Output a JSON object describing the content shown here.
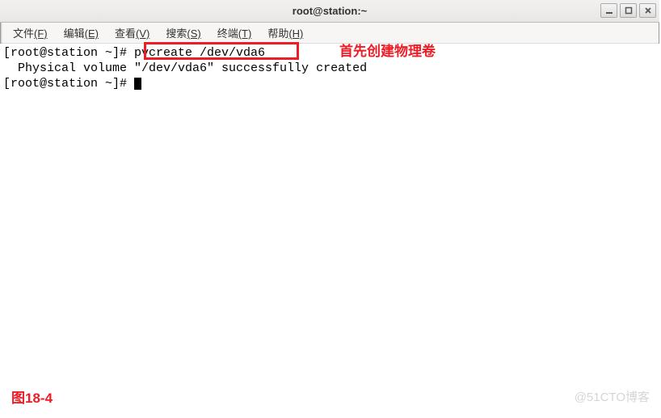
{
  "window": {
    "title": "root@station:~"
  },
  "menu": {
    "file": {
      "label": "文件",
      "accel": "(F)"
    },
    "edit": {
      "label": "编辑",
      "accel": "(E)"
    },
    "view": {
      "label": "查看",
      "accel": "(V)"
    },
    "search": {
      "label": "搜索",
      "accel": "(S)"
    },
    "terminal": {
      "label": "终端",
      "accel": "(T)"
    },
    "help": {
      "label": "帮助",
      "accel": "(H)"
    }
  },
  "terminal": {
    "prompt1_left": "[root@station ~]# ",
    "prompt1_cmd": "pvcreate /dev/vda6",
    "output1": "  Physical volume \"/dev/vda6\" successfully created",
    "prompt2": "[root@station ~]# "
  },
  "annotations": {
    "callout1": "首先创建物理卷",
    "figure_label": "图18-4"
  },
  "watermark": "@51CTO博客"
}
